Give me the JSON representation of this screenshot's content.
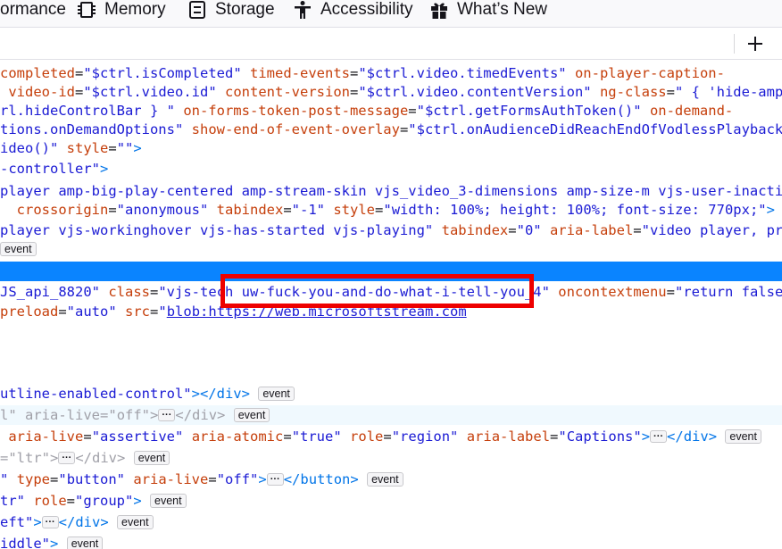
{
  "tabs": [
    {
      "label": "ormance",
      "icon": "performance-icon"
    },
    {
      "label": "Memory",
      "icon": "memory-icon"
    },
    {
      "label": "Storage",
      "icon": "storage-icon"
    },
    {
      "label": "Accessibility",
      "icon": "accessibility-icon"
    },
    {
      "label": "What’s New",
      "icon": "gift-icon"
    }
  ],
  "toolbar": {
    "add_label": "+"
  },
  "lines": {
    "l1": {
      "a1": "completed",
      "v1": "\"$ctrl.isCompleted\"",
      "a2": "timed-events",
      "v2": "\"$ctrl.video.timedEvents\"",
      "a3": "on-player-caption-"
    },
    "l2": {
      "a1": "video-id",
      "v1": "\"$ctrl.video.id\"",
      "a2": "content-version",
      "v2": "\"$ctrl.video.contentVersion\"",
      "a3": "ng-class",
      "v3": "\" { 'hide-amp-"
    },
    "l3": {
      "v0": "rl.hideControlBar } \"",
      "a1": "on-forms-token-post-message",
      "v1": "\"$ctrl.getFormsAuthToken()\"",
      "a2": "on-demand-"
    },
    "l4": {
      "a0": "tions.onDemandOptions\"",
      "a1": "show-end-of-event-overlay",
      "v1": "\"$ctrl.onAudienceDidReachEndOfVodlessPlayback()\""
    },
    "l5": {
      "v0": "ideo()\"",
      "a1": "style",
      "v1": "\"\""
    },
    "l6": {
      "v0": "-controller\""
    },
    "l7": {
      "v0": "player amp-big-play-centered amp-stream-skin vjs_video_3-dimensions amp-size-m vjs-user-inactive\""
    },
    "l8": {
      "a1": "crossorigin",
      "v1": "\"anonymous\"",
      "a2": "tabindex",
      "v2": "\"-1\"",
      "a3": "style",
      "v3": "\"width: 100%; height: 100%; font-size: 770px;\"",
      "badge": "event"
    },
    "l9": {
      "v0": "player vjs-workinghover vjs-has-started vjs-playing\"",
      "a1": "tabindex",
      "v1": "\"0\"",
      "a2": "aria-label",
      "v2": "\"video player, press"
    },
    "l10": {
      "badge": "event"
    },
    "l11": {
      "v0": "JS_api_8820\"",
      "a1": "class",
      "v1a": "\"vjs-tech ",
      "v1b": "uw-fuck-you-and-do-what-i-tell-you_4\"",
      "a2": "oncontextmenu",
      "v2": "\"return false;\""
    },
    "l12": {
      "a0": "preload",
      "v0": "\"auto\"",
      "a1": "src",
      "v1q": "\"",
      "v1": "blob:https://web.microsoftstream.com"
    },
    "l13": {
      "v0": "utline-enabled-control\"",
      "tag": "></div>",
      "badge": "event"
    },
    "l14": {
      "v0": "l\"",
      "a1": "aria-live",
      "v1": "\"off\"",
      "tag": "</div>",
      "badge": "event"
    },
    "l15": {
      "a1": "aria-live",
      "v1": "\"assertive\"",
      "a2": "aria-atomic",
      "v2": "\"true\"",
      "a3": "role",
      "v3": "\"region\"",
      "a4": "aria-label",
      "v4": "\"Captions\"",
      "tag": "</div>",
      "badge": "event"
    },
    "l16": {
      "v0": "=\"ltr\"",
      "tag": "</div>",
      "badge": "event"
    },
    "l17": {
      "v0": "\"",
      "a1": "type",
      "v1": "\"button\"",
      "a2": "aria-live",
      "v2": "\"off\"",
      "tag": "</button>",
      "badge": "event"
    },
    "l18": {
      "v0": "tr\"",
      "a1": "role",
      "v1": "\"group\"",
      "badge": "event"
    },
    "l19": {
      "v0": "eft\"",
      "tag": "</div>",
      "badge": "event"
    },
    "l20": {
      "v0": "iddle\"",
      "badge": "event"
    }
  },
  "colors": {
    "selection": "#0a84ff",
    "highlight": "#ee0000",
    "attr_name": "#c53e0a",
    "attr_value": "#1a1ad4"
  }
}
